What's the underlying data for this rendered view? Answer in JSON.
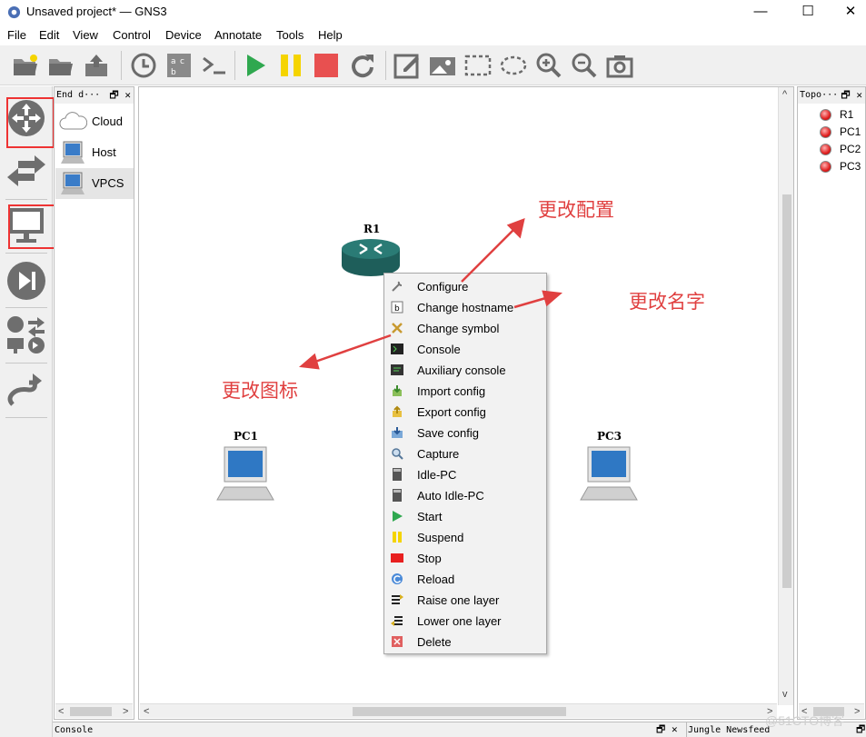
{
  "window": {
    "title": "Unsaved project* — GNS3",
    "min": "—",
    "max": "☐",
    "close": "✕"
  },
  "menu": [
    "File",
    "Edit",
    "View",
    "Control",
    "Device",
    "Annotate",
    "Tools",
    "Help"
  ],
  "devices_panel": {
    "title": "End d···",
    "items": [
      "Cloud",
      "Host",
      "VPCS"
    ],
    "selected": "VPCS"
  },
  "canvas": {
    "nodes": [
      {
        "name": "R1",
        "type": "router"
      },
      {
        "name": "PC1",
        "type": "pc"
      },
      {
        "name": "PC3",
        "type": "pc"
      }
    ]
  },
  "context_menu": [
    {
      "label": "Configure",
      "icon": "wrench-icon"
    },
    {
      "label": "Change hostname",
      "icon": "rename-icon"
    },
    {
      "label": "Change symbol",
      "icon": "symbol-icon"
    },
    {
      "label": "Console",
      "icon": "terminal-icon"
    },
    {
      "label": "Auxiliary console",
      "icon": "aux-terminal-icon"
    },
    {
      "label": "Import config",
      "icon": "import-icon"
    },
    {
      "label": "Export config",
      "icon": "export-icon"
    },
    {
      "label": "Save config",
      "icon": "save-icon"
    },
    {
      "label": "Capture",
      "icon": "magnifier-icon"
    },
    {
      "label": "Idle-PC",
      "icon": "calculator-icon"
    },
    {
      "label": "Auto Idle-PC",
      "icon": "calculator-icon"
    },
    {
      "label": "Start",
      "icon": "play-icon"
    },
    {
      "label": "Suspend",
      "icon": "pause-icon"
    },
    {
      "label": "Stop",
      "icon": "stop-icon"
    },
    {
      "label": "Reload",
      "icon": "reload-icon"
    },
    {
      "label": "Raise one layer",
      "icon": "raise-layer-icon"
    },
    {
      "label": "Lower one layer",
      "icon": "lower-layer-icon"
    },
    {
      "label": "Delete",
      "icon": "delete-icon"
    }
  ],
  "annotations": {
    "configure": "更改配置",
    "hostname": "更改名字",
    "symbol": "更改图标"
  },
  "topology_panel": {
    "title": "Topo···",
    "nodes": [
      "R1",
      "PC1",
      "PC2",
      "PC3"
    ],
    "status_color": "#e02020"
  },
  "bottom": {
    "console": "Console",
    "newsfeed": "Jungle Newsfeed"
  },
  "watermark": "@51CTO博客",
  "colors": {
    "annotation": "#e04040",
    "start_green": "#2fa84f",
    "suspend_yellow": "#f5d400",
    "stop_red": "#e85050"
  }
}
